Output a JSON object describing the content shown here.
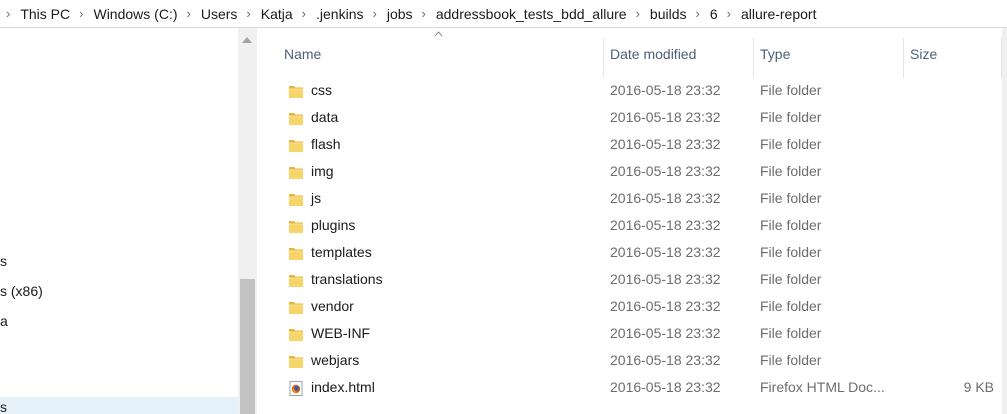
{
  "breadcrumbs": [
    "This PC",
    "Windows (C:)",
    "Users",
    "Katja",
    ".jenkins",
    "jobs",
    "addressbook_tests_bdd_allure",
    "builds",
    "6",
    "allure-report"
  ],
  "nav_pane": {
    "items": [
      {
        "label": "s"
      },
      {
        "label": "s (x86)"
      },
      {
        "label": "a"
      },
      {
        "label": "s"
      }
    ]
  },
  "columns": {
    "name": "Name",
    "date_modified": "Date modified",
    "type": "Type",
    "size": "Size",
    "sort_indicator": "sort-ascending-icon"
  },
  "files": [
    {
      "name": "css",
      "date": "2016-05-18 23:32",
      "type": "File folder",
      "size": "",
      "icon": "folder-icon"
    },
    {
      "name": "data",
      "date": "2016-05-18 23:32",
      "type": "File folder",
      "size": "",
      "icon": "folder-icon"
    },
    {
      "name": "flash",
      "date": "2016-05-18 23:32",
      "type": "File folder",
      "size": "",
      "icon": "folder-icon"
    },
    {
      "name": "img",
      "date": "2016-05-18 23:32",
      "type": "File folder",
      "size": "",
      "icon": "folder-icon"
    },
    {
      "name": "js",
      "date": "2016-05-18 23:32",
      "type": "File folder",
      "size": "",
      "icon": "folder-icon"
    },
    {
      "name": "plugins",
      "date": "2016-05-18 23:32",
      "type": "File folder",
      "size": "",
      "icon": "folder-icon"
    },
    {
      "name": "templates",
      "date": "2016-05-18 23:32",
      "type": "File folder",
      "size": "",
      "icon": "folder-icon"
    },
    {
      "name": "translations",
      "date": "2016-05-18 23:32",
      "type": "File folder",
      "size": "",
      "icon": "folder-icon"
    },
    {
      "name": "vendor",
      "date": "2016-05-18 23:32",
      "type": "File folder",
      "size": "",
      "icon": "folder-icon"
    },
    {
      "name": "WEB-INF",
      "date": "2016-05-18 23:32",
      "type": "File folder",
      "size": "",
      "icon": "folder-icon"
    },
    {
      "name": "webjars",
      "date": "2016-05-18 23:32",
      "type": "File folder",
      "size": "",
      "icon": "folder-icon"
    },
    {
      "name": "index.html",
      "date": "2016-05-18 23:32",
      "type": "Firefox HTML Doc...",
      "size": "9 KB",
      "icon": "firefox-document-icon"
    }
  ],
  "colors": {
    "header_text": "#4c607a",
    "detail_text": "#6d6d6d",
    "folder_yellow": "#f7c948",
    "nav_selection": "#e5f1fb"
  }
}
